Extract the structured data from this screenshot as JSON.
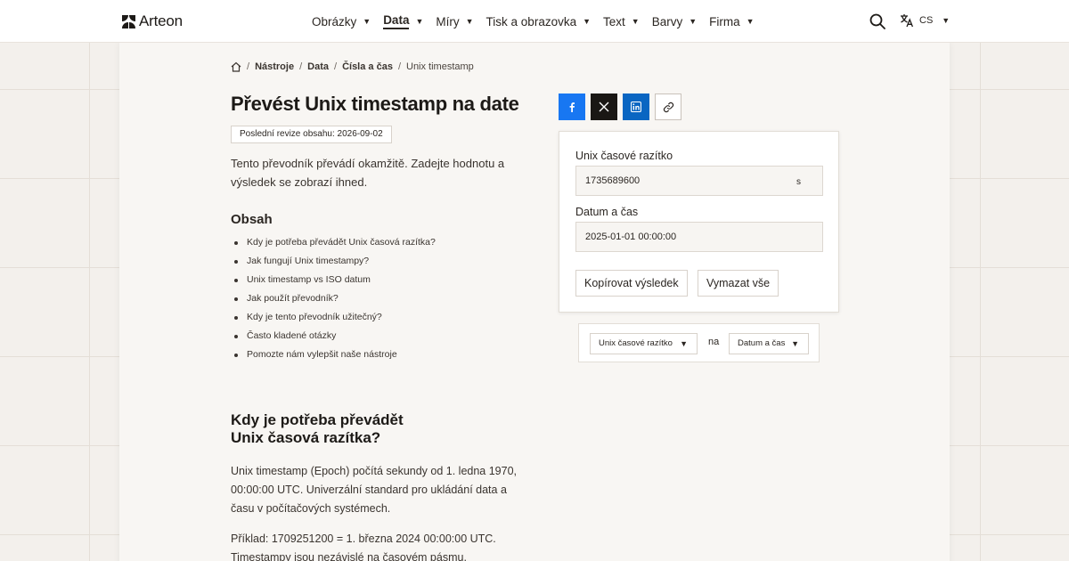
{
  "brand": {
    "name": "Arteon"
  },
  "nav": {
    "items": [
      {
        "label": "Obrázky",
        "active": false
      },
      {
        "label": "Data",
        "active": true
      },
      {
        "label": "Míry",
        "active": false
      },
      {
        "label": "Tisk a obrazovka",
        "active": false
      },
      {
        "label": "Text",
        "active": false
      },
      {
        "label": "Barvy",
        "active": false
      },
      {
        "label": "Firma",
        "active": false
      }
    ],
    "caret": "▼"
  },
  "header": {
    "language": "CS",
    "search_icon": "search-icon",
    "translate_icon": "translate-icon"
  },
  "breadcrumb": {
    "separator": "/",
    "items": [
      "Nástroje",
      "Data",
      "Čísla a čas"
    ],
    "current": "Unix timestamp"
  },
  "page": {
    "title": "Převést Unix timestamp na date",
    "revision": "Poslední revize obsahu: 2026-09-02",
    "intro": "Tento převodník převádí okamžitě. Zadejte hodnotu a výsledek se zobrazí ihned."
  },
  "toc": {
    "title": "Obsah",
    "items": [
      "Kdy je potřeba převádět Unix časová razítka?",
      "Jak fungují Unix timestampy?",
      "Unix timestamp vs ISO datum",
      "Jak použít převodník?",
      "Kdy je tento převodník užitečný?",
      "Často kladené otázky",
      "Pomozte nám vylepšit naše nástroje"
    ]
  },
  "section": {
    "title_line1": "Kdy je potřeba převádět",
    "title_line2": "Unix časová razítka?",
    "para1": "Unix timestamp (Epoch) počítá sekundy od 1. ledna 1970, 00:00:00 UTC. Univerzální standard pro ukládání data a času v počítačových systémech.",
    "para2": "Příklad: 1709251200 = 1. března 2024 00:00:00 UTC. Timestampy jsou nezávislé na časovém pásmu."
  },
  "share": {
    "icons": [
      "facebook-icon",
      "x-icon",
      "linkedin-icon",
      "link-icon"
    ]
  },
  "converter": {
    "input_label": "Unix časové razítko",
    "input_value": "1735689600",
    "input_unit": "s",
    "output_label": "Datum a čas",
    "output_value": "2025-01-01 00:00:00",
    "copy_label": "Kopírovat výsledek",
    "clear_label": "Vymazat vše"
  },
  "switcher": {
    "from": "Unix časové razítko",
    "word": "na",
    "to": "Datum a čas"
  },
  "colors": {
    "facebook": "#1877f2",
    "x": "#1a1714",
    "linkedin": "#0a66c2",
    "background": "#f3f0ec"
  }
}
